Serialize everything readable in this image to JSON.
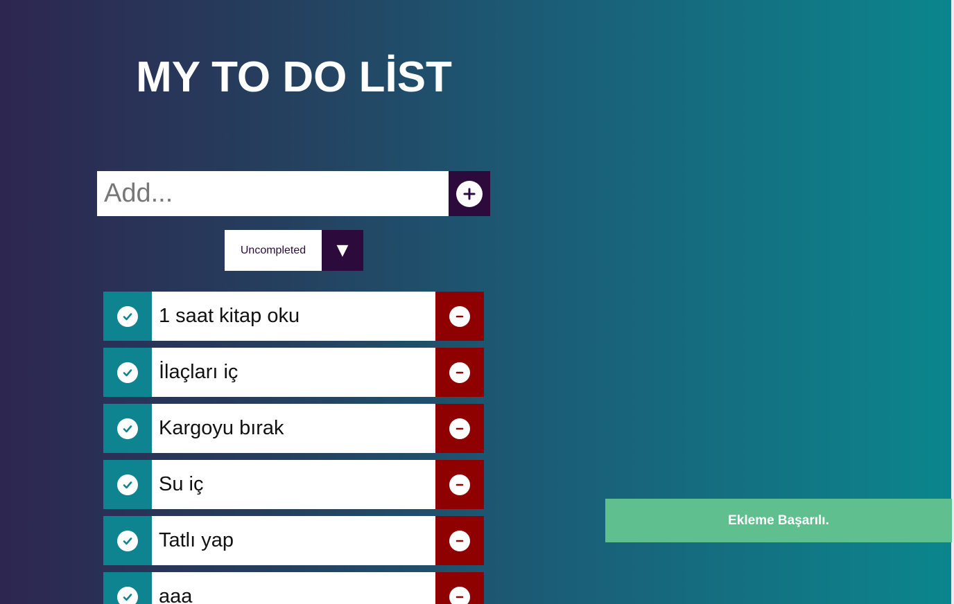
{
  "header": {
    "title": "MY TO DO LİST"
  },
  "add_form": {
    "placeholder": "Add...",
    "value": "",
    "add_icon": "plus-icon"
  },
  "filter": {
    "selected": "Uncompleted",
    "arrow_icon": "caret-down-icon",
    "arrow_glyph": "▼"
  },
  "todos": [
    {
      "text": "1 saat kitap oku"
    },
    {
      "text": "İlaçları iç"
    },
    {
      "text": "Kargoyu bırak"
    },
    {
      "text": "Su iç"
    },
    {
      "text": "Tatlı yap"
    },
    {
      "text": "aaa"
    }
  ],
  "toast": {
    "message": "Ekleme Başarılı."
  },
  "colors": {
    "complete_button": "#0e8490",
    "delete_button": "#8f0101",
    "add_button": "#2c0a3c",
    "toast": "#5fbf8e"
  }
}
